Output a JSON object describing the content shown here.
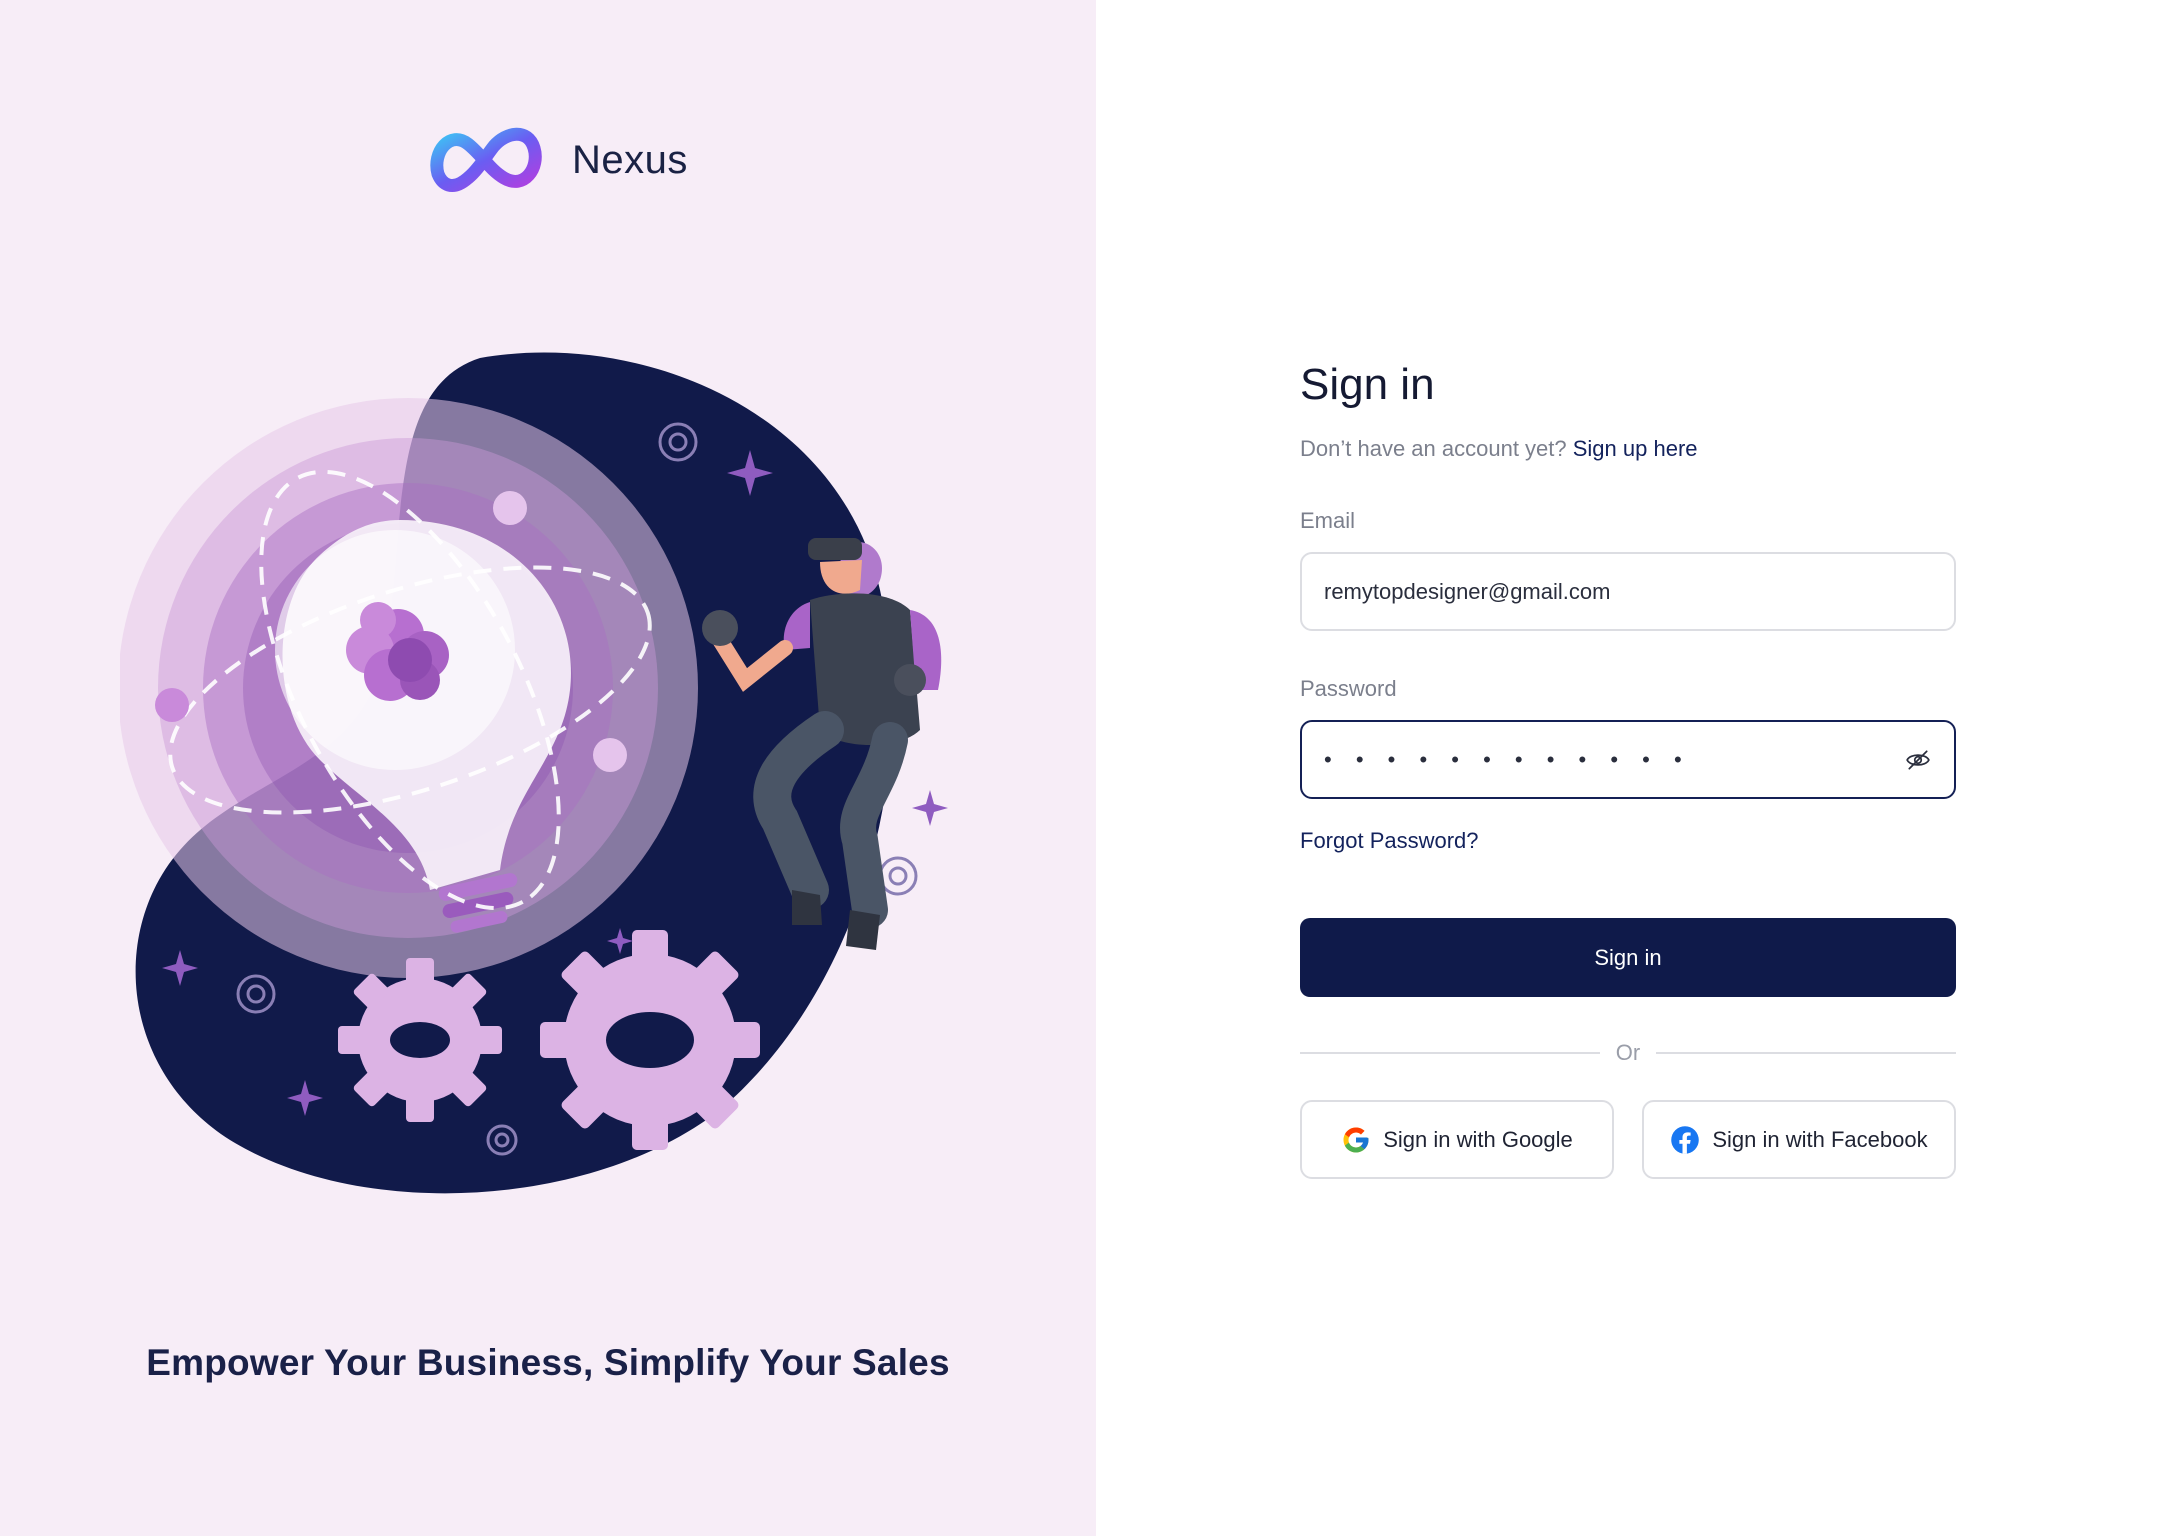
{
  "brand": {
    "name": "Nexus"
  },
  "hero": {
    "tagline": "Empower Your Business, Simplify Your Sales"
  },
  "form": {
    "title": "Sign in",
    "subtitle_prefix": "Don’t have an account yet?",
    "signup_link": "Sign up here",
    "email_label": "Email",
    "email_value": "remytopdesigner@gmail.com",
    "password_label": "Password",
    "password_value": "• • • • • • • • • • • •",
    "forgot_link": "Forgot Password?",
    "submit_label": "Sign in",
    "divider_text": "Or",
    "google_label": "Sign in with Google",
    "facebook_label": "Sign in with Facebook"
  },
  "colors": {
    "left_bg": "#f7edf7",
    "primary": "#0f1a4a",
    "link": "#13225c",
    "blob": "#111a4a",
    "accent_purple": "#b76fd0"
  },
  "icons": {
    "logo": "infinity-logo",
    "password_toggle": "eye-off-icon",
    "google": "google-icon",
    "facebook": "facebook-icon"
  }
}
